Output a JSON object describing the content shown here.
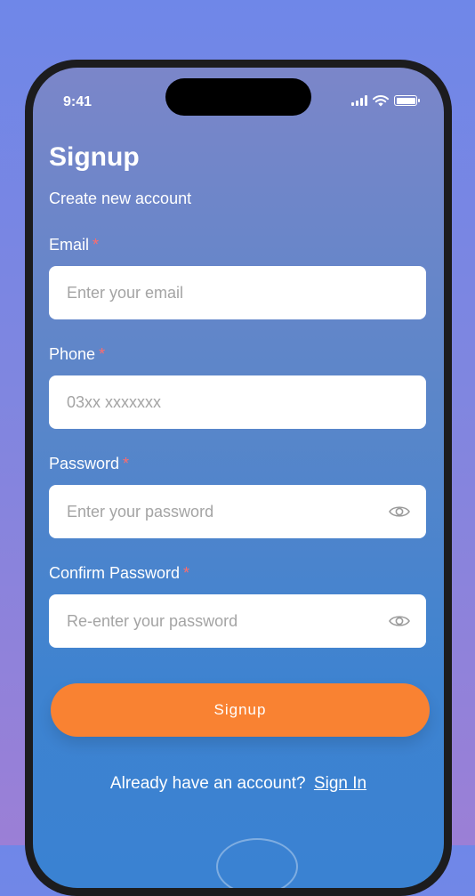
{
  "status_bar": {
    "time": "9:41"
  },
  "header": {
    "title": "Signup",
    "subtitle": "Create new account"
  },
  "form": {
    "email": {
      "label": "Email",
      "required": "*",
      "placeholder": "Enter your email",
      "value": ""
    },
    "phone": {
      "label": "Phone",
      "required": "*",
      "placeholder": "03xx xxxxxxx",
      "value": ""
    },
    "password": {
      "label": "Password",
      "required": "*",
      "placeholder": "Enter your password",
      "value": "",
      "icon": "eye-icon"
    },
    "confirm_password": {
      "label": "Confirm Password",
      "required": "*",
      "placeholder": "Re-enter your password",
      "value": "",
      "icon": "eye-icon"
    }
  },
  "actions": {
    "signup_label": "Signup"
  },
  "footer": {
    "prompt": "Already have an account?",
    "link": "Sign In"
  },
  "colors": {
    "accent": "#f98232",
    "required": "#ff6b6b",
    "background_top": "#6f87e8",
    "background_bottom": "#9b7fd6"
  }
}
